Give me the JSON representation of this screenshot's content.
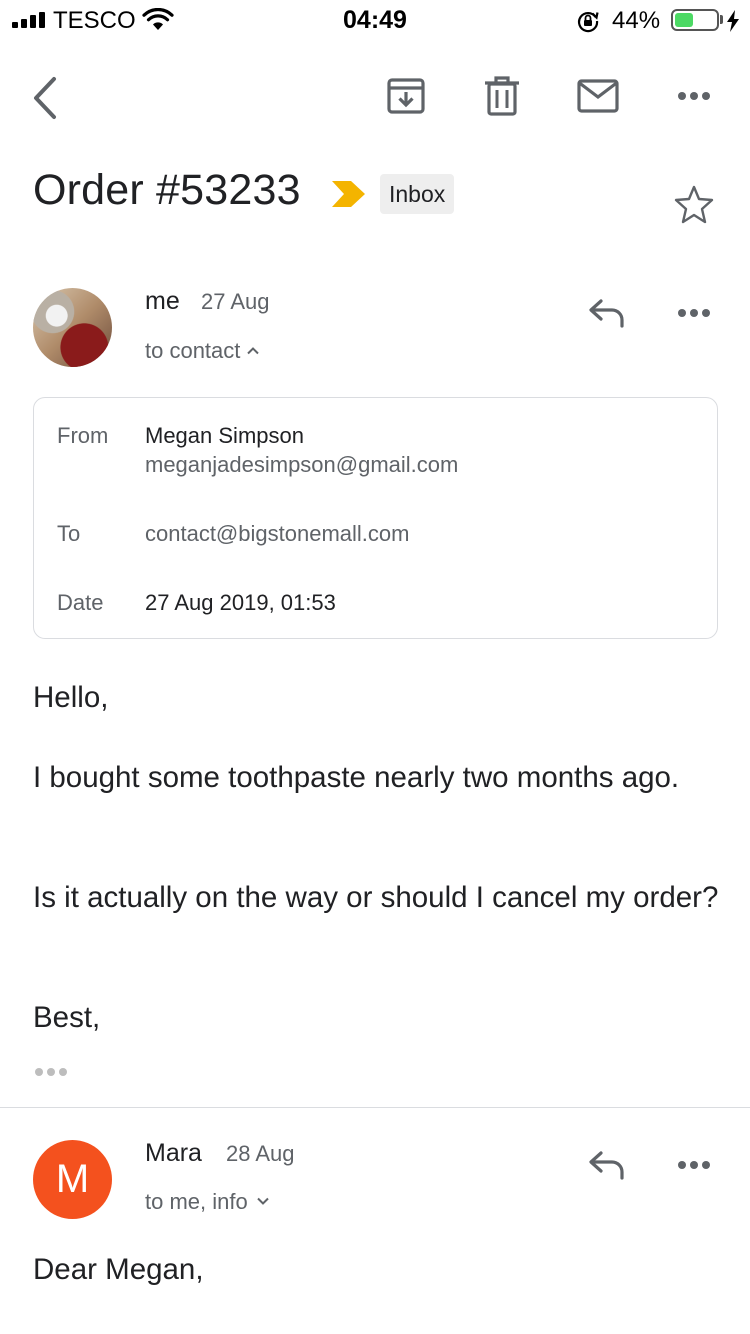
{
  "status_bar": {
    "carrier": "TESCO",
    "time": "04:49",
    "battery_percent": "44%",
    "battery_level": 0.44,
    "icons": [
      "signal-icon",
      "wifi-icon",
      "rotation-lock-icon",
      "battery-icon",
      "charging-bolt-icon"
    ]
  },
  "toolbar": {
    "icons": [
      "back-arrow-icon",
      "archive-icon",
      "delete-icon",
      "mark-unread-icon",
      "more-options-icon"
    ]
  },
  "thread": {
    "subject": "Order #53233",
    "label": "Inbox",
    "importance_color": "#f4b400"
  },
  "message1": {
    "sender": "me",
    "date": "27 Aug",
    "recipients": "to contact",
    "details": {
      "from_label": "From",
      "from_name": "Megan Simpson",
      "from_email": "meganjadesimpson@gmail.com",
      "to_label": "To",
      "to_value": "contact@bigstonemall.com",
      "date_label": "Date",
      "date_value": "27 Aug 2019, 01:53"
    },
    "body": [
      "Hello,",
      "I bought some toothpaste nearly two months ago.",
      "Is it actually on the way or should I cancel my order?",
      "Best,"
    ]
  },
  "message2": {
    "avatar_letter": "M",
    "avatar_color": "#f4511e",
    "sender": "Mara",
    "date": "28 Aug",
    "recipients": "to me, info",
    "greeting": "Dear Megan,"
  }
}
